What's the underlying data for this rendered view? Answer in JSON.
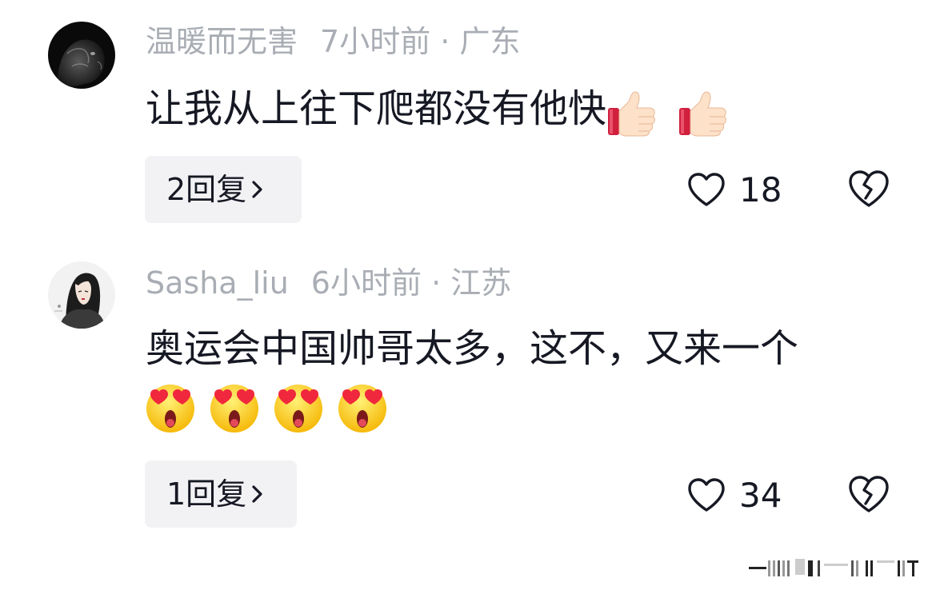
{
  "comments": [
    {
      "username": "温暖而无害",
      "time": "7小时前",
      "separator": "·",
      "location": "广东",
      "text": "让我从上往下爬都没有他快",
      "emojis": [
        "thumbs-up-icon",
        "thumbs-up-icon"
      ],
      "reply_label": "2回复",
      "likes": "18"
    },
    {
      "username": "Sasha_liu",
      "time": "6小时前",
      "separator": "·",
      "location": "江苏",
      "text": "奥运会中国帅哥太多，这不，又来一个",
      "emojis": [
        "heart-eyes-face-icon",
        "heart-eyes-face-icon",
        "heart-eyes-face-icon",
        "heart-eyes-face-icon"
      ],
      "reply_label": "1回复",
      "likes": "34"
    }
  ],
  "colors": {
    "meta_text": "#a9adb4",
    "body_text": "#161823",
    "reply_bg": "#f2f2f4"
  }
}
